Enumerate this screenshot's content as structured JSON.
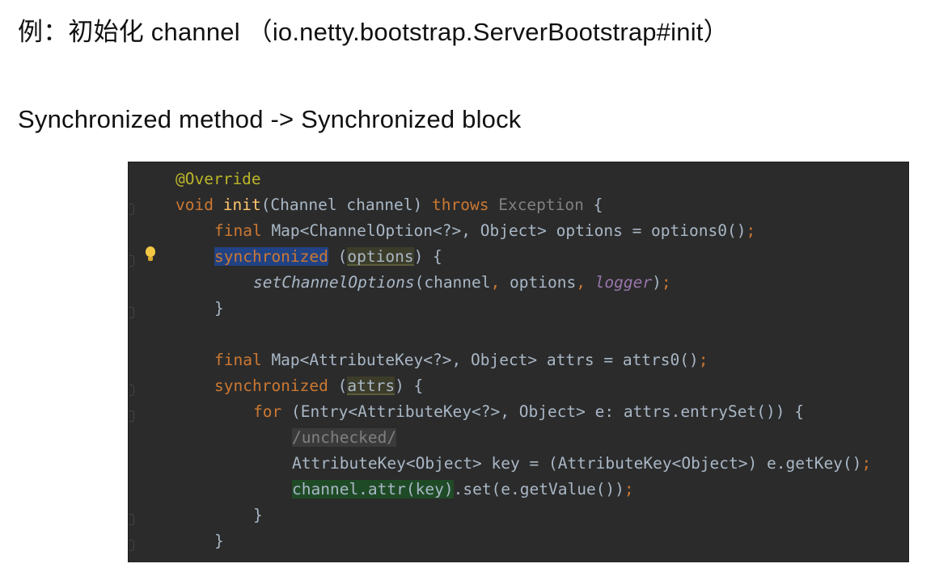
{
  "headings": {
    "line1": "例：初始化 channel （io.netty.bootstrap.ServerBootstrap#init）",
    "line2": "Synchronized method -> Synchronized block"
  },
  "icons": {
    "lightbulb": "lightbulb-icon",
    "gutter_markers": "fold-marker-icon"
  },
  "colors": {
    "page_background": "#ffffff",
    "editor_background": "#2b2b2b",
    "keyword": "#cc7832",
    "annotation": "#bbb529",
    "method_declaration": "#ffc66d",
    "default_text": "#a9b7c6",
    "static_field": "#9876aa",
    "selection_highlight": "#214283",
    "usage_highlight": "#1f4a26",
    "lightbulb": "#f2c744"
  },
  "code": {
    "l1": "@Override",
    "l2": {
      "kw_void": "void",
      "method": "init",
      "params": "(Channel channel) ",
      "kw_throws": "throws",
      "exc": " Exception",
      "brace": " {"
    },
    "l3": {
      "kw_final": "final",
      "type": " Map<ChannelOption<?>, Object> options = options0()",
      "semi": ";"
    },
    "l4": {
      "kw_sync": "synchronized",
      "open": " (",
      "arg": "options",
      "close": ") {"
    },
    "l5": {
      "call": "setChannelOptions",
      "args1": "(channel",
      "c1": ",",
      "args2": " options",
      "c2": ",",
      "logger": " logger",
      "end": ")",
      "semi": ";"
    },
    "l6": "}",
    "l7": "",
    "l8": {
      "kw_final": "final",
      "type": " Map<AttributeKey<?>, Object> attrs = attrs0()",
      "semi": ";"
    },
    "l9": {
      "kw_sync": "synchronized",
      "open": " (",
      "arg": "attrs",
      "close": ") {"
    },
    "l10": {
      "kw_for": "for",
      "rest": " (Entry<AttributeKey<?>, Object> e: attrs.entrySet()) {"
    },
    "l11": "/unchecked/",
    "l12": {
      "text": "AttributeKey<Object> key = (AttributeKey<Object>) e.getKey()",
      "semi": ";"
    },
    "l13": {
      "hl": "channel.attr(key)",
      "rest": ".set(e.getValue())",
      "semi": ";"
    },
    "l14": "}",
    "l15": "}"
  }
}
